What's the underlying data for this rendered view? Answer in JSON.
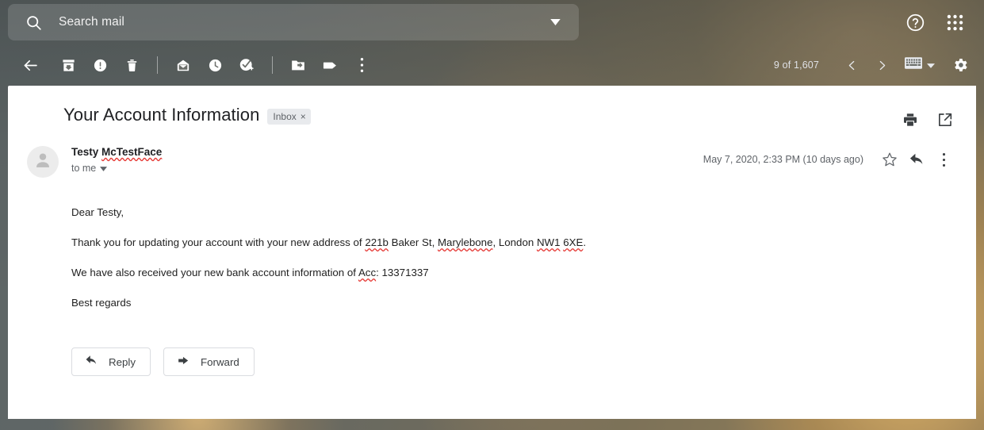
{
  "app": {
    "name": "Gmail"
  },
  "search": {
    "placeholder": "Search mail",
    "value": "",
    "icon": "search-icon",
    "options_icon": "chevron-down-icon"
  },
  "header": {
    "help_icon": "help-circle-icon",
    "apps_icon": "apps-grid-icon"
  },
  "toolbar": {
    "back_icon": "arrow-back-icon",
    "archive_icon": "archive-icon",
    "spam_icon": "report-spam-icon",
    "delete_icon": "trash-icon",
    "unread_icon": "mark-unread-icon",
    "snooze_icon": "clock-snooze-icon",
    "tasks_icon": "add-to-tasks-icon",
    "moveto_icon": "move-to-folder-icon",
    "labels_icon": "label-tag-icon",
    "more_icon": "more-vertical-icon",
    "count_text": "9 of 1,607",
    "prev_icon": "chevron-left-icon",
    "next_icon": "chevron-right-icon",
    "keyboard_icon": "keyboard-icon",
    "keyboard_caret_icon": "caret-down-icon",
    "settings_icon": "gear-icon"
  },
  "message": {
    "subject": "Your Account Information",
    "label": {
      "name": "Inbox",
      "remove": "×"
    },
    "print_icon": "printer-icon",
    "popout_icon": "open-in-new-icon",
    "sender": {
      "first": "Testy",
      "last": "McTestFace"
    },
    "recipient": "to me",
    "recipient_caret_icon": "caret-down-icon",
    "date": "May 7, 2020, 2:33 PM (10 days ago)",
    "star_icon": "star-outline-icon",
    "reply_arrow_icon": "reply-arrow-icon",
    "more_icon": "more-vertical-icon",
    "avatar_icon": "person-avatar-icon",
    "body": {
      "greeting": "Dear Testy,",
      "para2_pre": "Thank you for updating your account with your new address of ",
      "para2_addr1": "221b",
      "para2_mid1": " Baker St, ",
      "para2_addr2": "Marylebone",
      "para2_mid2": ", London ",
      "para2_addr3": "NW1",
      "para2_mid3": " ",
      "para2_addr4": "6XE",
      "para2_end": ".",
      "para3_pre": "We have also received your new bank account information of ",
      "para3_acc": "Acc",
      "para3_post": ": 13371337",
      "signoff": "Best regards"
    },
    "reply_button": {
      "label": "Reply",
      "icon": "reply-arrow-icon"
    },
    "forward_button": {
      "label": "Forward",
      "icon": "forward-arrow-icon"
    }
  },
  "colors": {
    "panel_bg": "#ffffff",
    "chip_bg": "#e8eaed",
    "text_primary": "#202124",
    "text_secondary": "#5f6368",
    "spellcheck": "#e53935",
    "button_border": "#dadce0"
  }
}
